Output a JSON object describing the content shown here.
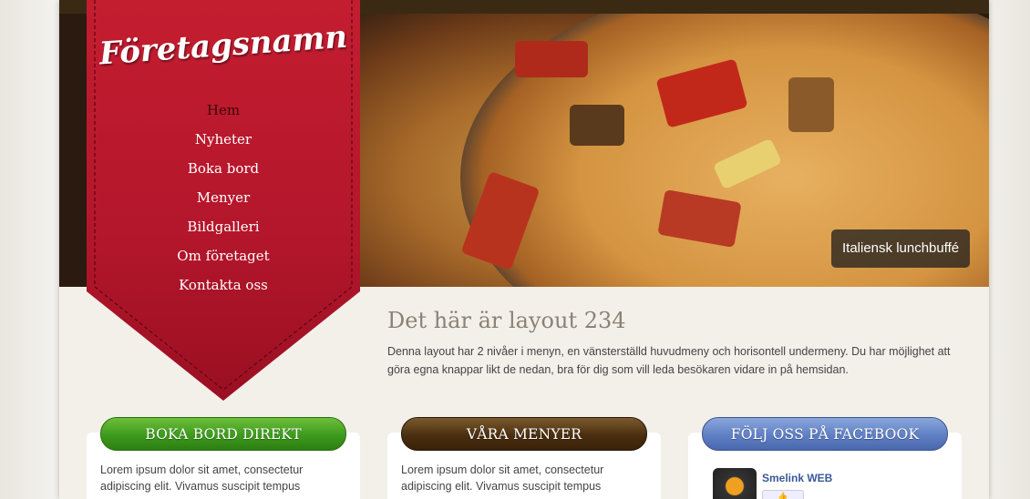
{
  "brand": {
    "logo_text": "Företagsnamn"
  },
  "nav": {
    "items": [
      {
        "label": "Hem"
      },
      {
        "label": "Nyheter"
      },
      {
        "label": "Boka bord"
      },
      {
        "label": "Menyer"
      },
      {
        "label": "Bildgalleri"
      },
      {
        "label": "Om företaget"
      },
      {
        "label": "Kontakta oss"
      }
    ],
    "active_index": 0
  },
  "hero": {
    "caption": "Italiensk lunchbuffé"
  },
  "intro": {
    "title": "Det här är layout 234",
    "body": "Denna layout har 2 nivåer i menyn, en vänsterställd huvudmeny och horisontell undermeny. Du har möjlighet att göra egna knappar likt de nedan, bra för dig som vill leda besökaren vidare in på hemsidan."
  },
  "boxes": [
    {
      "button_label": "BOKA BORD DIREKT",
      "text": "Lorem ipsum dolor sit amet, consectetur adipiscing elit. Vivamus suscipit tempus"
    },
    {
      "button_label": "VÅRA MENYER",
      "text": "Lorem ipsum dolor sit amet, consectetur adipiscing elit. Vivamus suscipit tempus"
    },
    {
      "button_label": "FÖLJ OSS PÅ FACEBOOK"
    }
  ],
  "facebook": {
    "page_name": "Smelink WEB"
  },
  "colors": {
    "ribbon": "#b3162b",
    "green_button": "#3d9a1c",
    "brown_button": "#4a2e10",
    "blue_button": "#5f7fc4"
  }
}
